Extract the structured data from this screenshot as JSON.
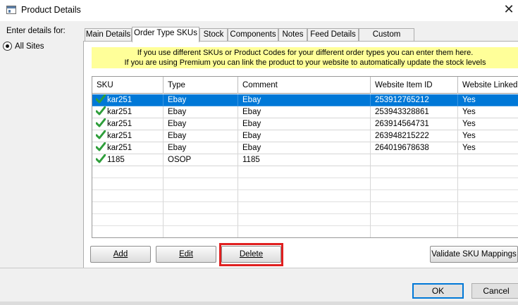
{
  "window": {
    "title": "Product Details",
    "close_glyph": "✕"
  },
  "left_panel": {
    "enter_label": "Enter details for:",
    "option_label": "All Sites",
    "option_selected": true
  },
  "tabs": [
    {
      "label": "Main Details",
      "active": false
    },
    {
      "label": "Order Type SKUs",
      "active": true
    },
    {
      "label": "Stock",
      "active": false
    },
    {
      "label": "Components",
      "active": false
    },
    {
      "label": "Notes",
      "active": false
    },
    {
      "label": "Feed Details",
      "active": false
    },
    {
      "label": "Custom Values",
      "active": false
    }
  ],
  "notice": {
    "line1": "If you use different SKUs or Product Codes for your different order types you can enter them here.",
    "line2": "If you are using Premium you can link the product to your website to automatically update the stock levels"
  },
  "grid": {
    "columns": [
      "SKU",
      "Type",
      "Comment",
      "Website Item ID",
      "Website Linked"
    ],
    "rows": [
      {
        "sku": "kar251",
        "type": "Ebay",
        "comment": "Ebay",
        "item_id": "253912765212",
        "linked": "Yes",
        "selected": true
      },
      {
        "sku": "kar251",
        "type": "Ebay",
        "comment": "Ebay",
        "item_id": "253943328861",
        "linked": "Yes",
        "selected": false
      },
      {
        "sku": "kar251",
        "type": "Ebay",
        "comment": "Ebay",
        "item_id": "263914564731",
        "linked": "Yes",
        "selected": false
      },
      {
        "sku": "kar251",
        "type": "Ebay",
        "comment": "Ebay",
        "item_id": "263948215222",
        "linked": "Yes",
        "selected": false
      },
      {
        "sku": "kar251",
        "type": "Ebay",
        "comment": "Ebay",
        "item_id": "264019678638",
        "linked": "Yes",
        "selected": false
      },
      {
        "sku": "1185",
        "type": "OSOP",
        "comment": "1185",
        "item_id": "",
        "linked": "",
        "selected": false
      }
    ],
    "row_icon": "check-icon"
  },
  "buttons": {
    "add": "Add",
    "edit": "Edit",
    "delete": "Delete",
    "validate": "Validate SKU Mappings",
    "ok": "OK",
    "cancel": "Cancel"
  },
  "colors": {
    "selection": "#0078d7",
    "notice_bg": "#ffff99",
    "highlight": "#e02020",
    "check": "#2e9e3a"
  }
}
